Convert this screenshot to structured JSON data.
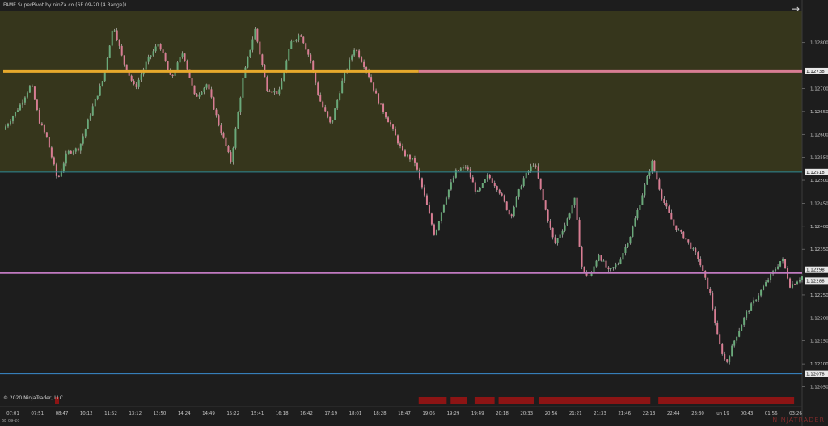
{
  "window": {
    "title": "FAME SuperPivot by ninZa.co (6E 09-20 (4 Range))",
    "expand_icon": "arrow-right-icon",
    "copyright": "© 2020 NinjaTrader, LLC",
    "contract": "6E 09-20",
    "brand": "NINJATRADER"
  },
  "colors": {
    "background": "#1d1d1d",
    "upper_zone": "#36361c",
    "upper_pivot": "#e6a92c",
    "pink_pivot": "#d87d93",
    "mid_line": "#2e8a95",
    "violet_line": "#c07ac0",
    "low_line": "#3a8ccf",
    "candle_up": "#6aa97a",
    "candle_down": "#d87d93",
    "signal": "#8c1414"
  },
  "chart_data": {
    "type": "candlestick",
    "instrument": "6E 09-20",
    "bar_type": "4 Range",
    "ylim": [
      1.12035,
      1.1287
    ],
    "y_ticks": [
      1.128,
      1.127,
      1.1265,
      1.126,
      1.1255,
      1.125,
      1.1245,
      1.124,
      1.1235,
      1.1225,
      1.122,
      1.1215,
      1.121,
      1.1205
    ],
    "x_tick_labels": [
      "07:01",
      "07:51",
      "08:47",
      "10:12",
      "11:52",
      "13:12",
      "13:50",
      "14:24",
      "14:49",
      "15:22",
      "15:41",
      "16:18",
      "16:42",
      "17:19",
      "18:01",
      "18:28",
      "18:47",
      "19:05",
      "19:29",
      "19:49",
      "20:18",
      "20:33",
      "20:56",
      "21:21",
      "21:33",
      "21:46",
      "22:13",
      "22:44",
      "23:30",
      "Jun 19",
      "00:43",
      "01:56",
      "03:26"
    ],
    "levels": [
      {
        "value": 1.12738,
        "label": "1.12738",
        "style": "thick"
      },
      {
        "value": 1.12518,
        "label": "1.12518"
      },
      {
        "value": 1.12298,
        "label": "1.12298"
      },
      {
        "value": 1.12288,
        "label": "1.12288"
      },
      {
        "value": 1.12078,
        "label": "1.12078"
      }
    ],
    "upper_zone": [
      1.12518,
      1.1287
    ],
    "price_path": [
      [
        0,
        1.1261
      ],
      [
        0.02,
        1.1266
      ],
      [
        0.035,
        1.1271
      ],
      [
        0.045,
        1.1263
      ],
      [
        0.055,
        1.1259
      ],
      [
        0.068,
        1.125
      ],
      [
        0.08,
        1.1256
      ],
      [
        0.095,
        1.1257
      ],
      [
        0.11,
        1.1265
      ],
      [
        0.125,
        1.1272
      ],
      [
        0.138,
        1.1284
      ],
      [
        0.15,
        1.1276
      ],
      [
        0.165,
        1.127
      ],
      [
        0.18,
        1.1276
      ],
      [
        0.195,
        1.128
      ],
      [
        0.21,
        1.1272
      ],
      [
        0.225,
        1.1278
      ],
      [
        0.24,
        1.1268
      ],
      [
        0.255,
        1.1271
      ],
      [
        0.27,
        1.1262
      ],
      [
        0.285,
        1.1254
      ],
      [
        0.3,
        1.1272
      ],
      [
        0.315,
        1.1283
      ],
      [
        0.33,
        1.127
      ],
      [
        0.345,
        1.1269
      ],
      [
        0.36,
        1.128
      ],
      [
        0.372,
        1.1282
      ],
      [
        0.385,
        1.1276
      ],
      [
        0.395,
        1.1268
      ],
      [
        0.41,
        1.1262
      ],
      [
        0.425,
        1.1272
      ],
      [
        0.44,
        1.1279
      ],
      [
        0.455,
        1.1274
      ],
      [
        0.47,
        1.1267
      ],
      [
        0.485,
        1.1262
      ],
      [
        0.5,
        1.1256
      ],
      [
        0.515,
        1.1254
      ],
      [
        0.525,
        1.1248
      ],
      [
        0.54,
        1.1238
      ],
      [
        0.553,
        1.1246
      ],
      [
        0.567,
        1.1252
      ],
      [
        0.58,
        1.1253
      ],
      [
        0.593,
        1.1247
      ],
      [
        0.607,
        1.1251
      ],
      [
        0.62,
        1.1248
      ],
      [
        0.635,
        1.1242
      ],
      [
        0.65,
        1.125
      ],
      [
        0.665,
        1.1254
      ],
      [
        0.675,
        1.1246
      ],
      [
        0.69,
        1.1236
      ],
      [
        0.705,
        1.1241
      ],
      [
        0.715,
        1.1246
      ],
      [
        0.725,
        1.123
      ],
      [
        0.735,
        1.1229
      ],
      [
        0.745,
        1.1234
      ],
      [
        0.758,
        1.123
      ],
      [
        0.77,
        1.1232
      ],
      [
        0.785,
        1.1238
      ],
      [
        0.8,
        1.1247
      ],
      [
        0.812,
        1.1254
      ],
      [
        0.825,
        1.1246
      ],
      [
        0.84,
        1.124
      ],
      [
        0.855,
        1.1237
      ],
      [
        0.87,
        1.1233
      ],
      [
        0.885,
        1.1225
      ],
      [
        0.895,
        1.1215
      ],
      [
        0.905,
        1.121
      ],
      [
        0.915,
        1.1215
      ],
      [
        0.93,
        1.1221
      ],
      [
        0.945,
        1.1225
      ],
      [
        0.96,
        1.1229
      ],
      [
        0.975,
        1.1233
      ],
      [
        0.985,
        1.1227
      ],
      [
        1.0,
        1.1229
      ]
    ],
    "pivot_color_segments": [
      {
        "from": 0.0,
        "to": 0.52,
        "color": "upper_pivot"
      },
      {
        "from": 0.52,
        "to": 1.0,
        "color": "pink_pivot"
      }
    ],
    "signal_bar_segments": [
      [
        0.52,
        0.555
      ],
      [
        0.56,
        0.58
      ],
      [
        0.59,
        0.615
      ],
      [
        0.62,
        0.665
      ],
      [
        0.67,
        0.81
      ],
      [
        0.82,
        0.99
      ]
    ]
  }
}
